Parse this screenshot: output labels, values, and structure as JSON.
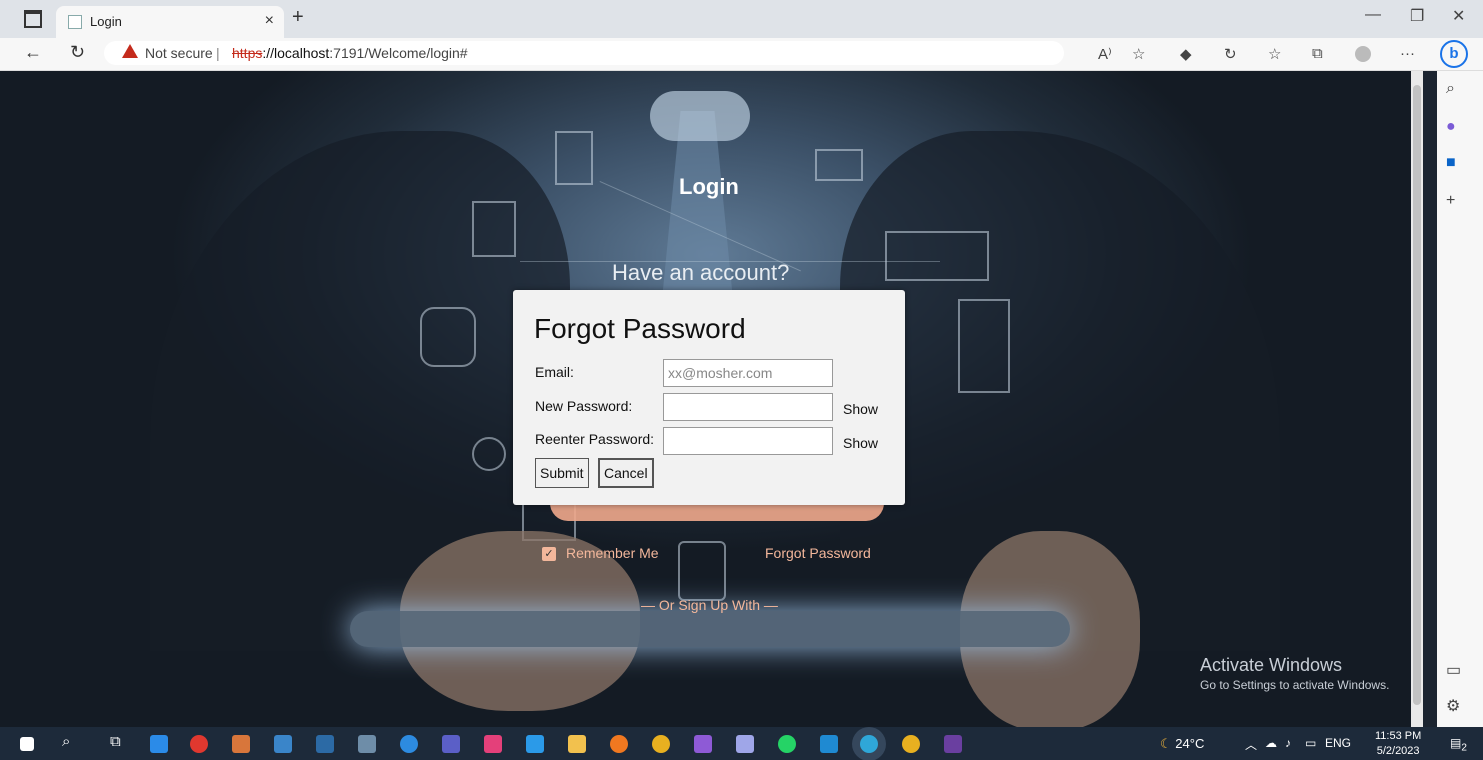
{
  "browser": {
    "tab_title": "Login",
    "tab_close": "×",
    "new_tab": "+",
    "not_secure": "Not secure",
    "separator": "|",
    "url_scheme": "https",
    "url_host": "://localhost",
    "url_path": ":7191/Welcome/login#",
    "read_aloud": "A⁾",
    "menu_dots": "···",
    "bing_label": "b"
  },
  "page": {
    "login_title": "Login",
    "have_account": "Have an account?",
    "remember_me": "Remember Me",
    "forgot_password_link": "Forgot Password",
    "or_sign_up": "— Or Sign Up With —",
    "watermark_title": "Activate Windows",
    "watermark_sub": "Go to Settings to activate Windows."
  },
  "modal": {
    "title": "Forgot Password",
    "email_label": "Email:",
    "email_placeholder": "xx@mosher.com",
    "new_password_label": "New Password:",
    "reenter_password_label": "Reenter Password:",
    "show_label": "Show",
    "submit_label": "Submit",
    "cancel_label": "Cancel"
  },
  "taskbar": {
    "temperature": "24°C",
    "language": "ENG",
    "time": "11:53 PM",
    "date": "5/2/2023",
    "notification_count": "2"
  },
  "colors": {
    "accent_peach": "#f3b79b",
    "not_secure_red": "#c42b1c",
    "bing_blue": "#1a73e8",
    "taskbar": "#1d2a3a"
  }
}
